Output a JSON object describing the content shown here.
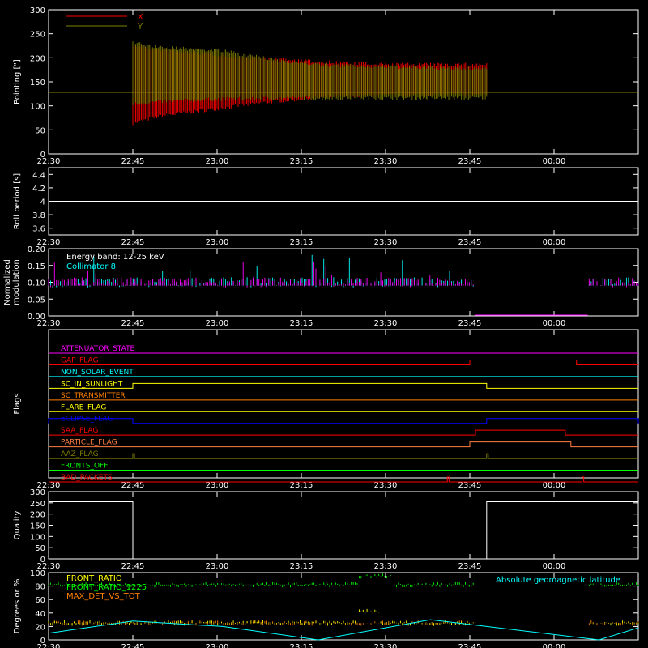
{
  "chart_data": [
    {
      "type": "line",
      "ylabel": "Pointing [\"]",
      "ylim": [
        0,
        300
      ],
      "yticks": [
        0,
        50,
        100,
        150,
        200,
        250,
        300
      ],
      "xlim": [
        "22:30",
        "00:15"
      ],
      "xticks": [
        "22:30",
        "22:45",
        "23:00",
        "23:15",
        "23:30",
        "23:45",
        "00:00"
      ],
      "legend": "top-left",
      "series": [
        {
          "name": "X",
          "color": "#ff0000",
          "x": [
            "22:45",
            "22:50",
            "23:00",
            "23:10",
            "23:20",
            "23:30",
            "23:40",
            "23:48"
          ],
          "min": [
            60,
            75,
            90,
            105,
            115,
            118,
            120,
            120
          ],
          "max": [
            230,
            220,
            210,
            200,
            195,
            190,
            190,
            190
          ]
        },
        {
          "name": "Y",
          "color": "#808000",
          "x": [
            "22:45",
            "22:50",
            "23:00",
            "23:10",
            "23:20",
            "23:30",
            "23:40",
            "23:48"
          ],
          "min": [
            100,
            105,
            110,
            112,
            112,
            112,
            112,
            112
          ],
          "max": [
            235,
            225,
            220,
            200,
            188,
            185,
            182,
            182
          ]
        }
      ],
      "baseline": 128
    },
    {
      "type": "line",
      "ylabel": "Roll period [s]",
      "ylim": [
        3.5,
        4.5
      ],
      "yticks": [
        3.6,
        3.8,
        4.0,
        4.2,
        4.4
      ],
      "xticks": [
        "22:30",
        "22:45",
        "23:00",
        "23:15",
        "23:30",
        "23:45",
        "00:00"
      ],
      "series": [
        {
          "name": "",
          "color": "#ffffff",
          "value": 4.0
        }
      ]
    },
    {
      "type": "line",
      "ylabel": "Normalized modulation",
      "ylim": [
        0,
        0.2
      ],
      "yticks": [
        "0.00",
        "0.05",
        "0.10",
        "0.15",
        "0.20"
      ],
      "xticks": [
        "22:30",
        "22:45",
        "23:00",
        "23:15",
        "23:30",
        "23:45",
        "00:00"
      ],
      "annotations": [
        "Energy band: 12-25 keV",
        "Collimator 8"
      ],
      "series": [
        {
          "name": "Collimator 8",
          "color": "#00ffff",
          "mean": 0.1
        },
        {
          "name": "",
          "color": "#ff00ff",
          "mean": 0.1,
          "gap": [
            "23:46",
            "00:06"
          ]
        }
      ]
    },
    {
      "type": "line",
      "ylabel": "Flags",
      "xticks": [
        "22:30",
        "22:45",
        "23:00",
        "23:15",
        "23:30",
        "23:45",
        "00:00"
      ],
      "flags": [
        {
          "name": "ATTENUATOR_STATE",
          "color": "#ff00ff",
          "high": []
        },
        {
          "name": "GAP_FLAG",
          "color": "#ff0000",
          "high": [
            [
              "23:45",
              "00:04"
            ]
          ]
        },
        {
          "name": "NON_SOLAR_EVENT",
          "color": "#00ffff",
          "high": []
        },
        {
          "name": "SC_IN_SUNLIGHT",
          "color": "#ffff00",
          "high": [
            [
              "22:45",
              "23:48"
            ]
          ]
        },
        {
          "name": "SC_TRANSMITTER",
          "color": "#ff8000",
          "high": []
        },
        {
          "name": "FLARE_FLAG",
          "color": "#ffff00",
          "high": []
        },
        {
          "name": "ECLIPSE_FLAG",
          "color": "#0000ff",
          "high": [
            [
              "22:30",
              "22:45"
            ],
            [
              "23:48",
              "00:15"
            ]
          ]
        },
        {
          "name": "SAA_FLAG",
          "color": "#ff0000",
          "high": [
            [
              "23:46",
              "00:02"
            ]
          ]
        },
        {
          "name": "PARTICLE_FLAG",
          "color": "#ff8040",
          "high": [
            [
              "23:45",
              "00:03"
            ]
          ]
        },
        {
          "name": "AAZ_FLAG",
          "color": "#808000",
          "high": [
            [
              "22:45",
              "22:45"
            ],
            [
              "23:48",
              "23:48"
            ]
          ]
        },
        {
          "name": "FRONTS_OFF",
          "color": "#00ff00",
          "high": []
        },
        {
          "name": "BAD_PACKETS",
          "color": "#ff0000",
          "high": [
            [
              "23:41",
              "23:41"
            ],
            [
              "00:05",
              "00:05"
            ]
          ]
        }
      ]
    },
    {
      "type": "line",
      "ylabel": "Quality",
      "ylim": [
        0,
        300
      ],
      "yticks": [
        0,
        50,
        100,
        150,
        200,
        250,
        300
      ],
      "xticks": [
        "22:30",
        "22:45",
        "23:00",
        "23:15",
        "23:30",
        "23:45",
        "00:00"
      ],
      "series": [
        {
          "name": "",
          "color": "#ffffff",
          "x": [
            "22:30",
            "22:45",
            "22:45",
            "23:48",
            "23:48",
            "00:15"
          ],
          "y": [
            255,
            255,
            0,
            0,
            255,
            255
          ]
        }
      ]
    },
    {
      "type": "line",
      "ylabel": "Degrees or %",
      "ylim": [
        0,
        100
      ],
      "yticks": [
        0,
        20,
        40,
        60,
        80,
        100
      ],
      "xticks": [
        "22:30",
        "22:45",
        "23:00",
        "23:15",
        "23:30",
        "23:45",
        "00:00"
      ],
      "series": [
        {
          "name": "FRONT_RATIO",
          "color": "#ffff00",
          "mean": 25
        },
        {
          "name": "FRONT_RATIO_1225",
          "color": "#00ff00",
          "mean": 82
        },
        {
          "name": "MAX_DET_VS_TOT",
          "color": "#ff8000",
          "mean": 25
        },
        {
          "name": "Absolute geomagnetic latitude",
          "color": "#00ffff",
          "x": [
            "22:30",
            "22:45",
            "23:01",
            "23:18",
            "23:38",
            "23:48",
            "00:08",
            "00:15"
          ],
          "y": [
            10,
            28,
            20,
            0,
            30,
            20,
            0,
            18
          ]
        }
      ]
    }
  ]
}
